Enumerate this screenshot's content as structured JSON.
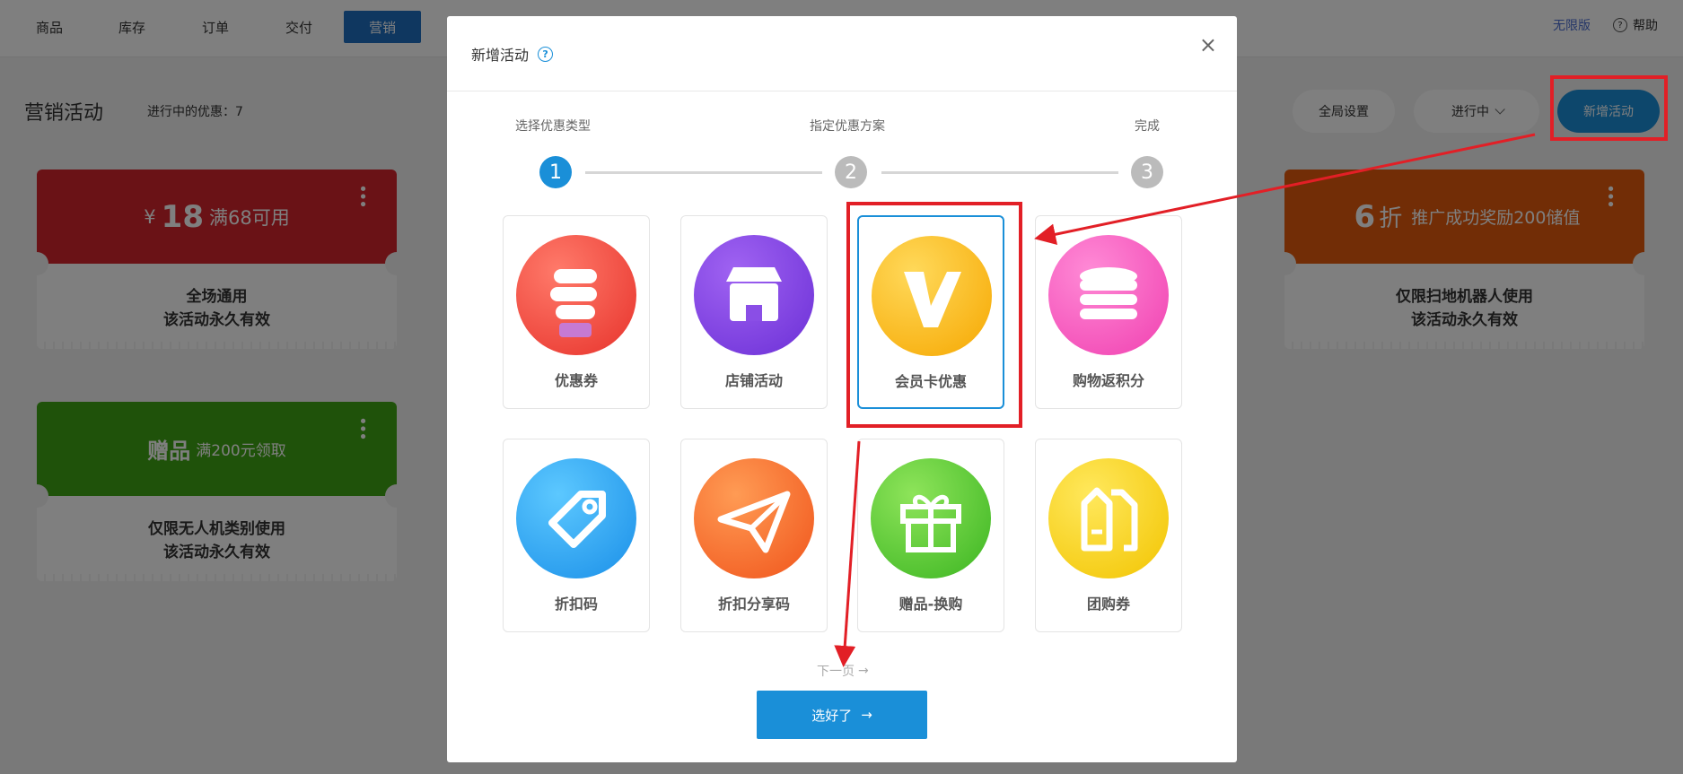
{
  "nav": {
    "tabs": [
      "商品",
      "库存",
      "订单",
      "交付",
      "营销"
    ],
    "active_index": 4,
    "right_link": "无限版",
    "help": "帮助"
  },
  "page": {
    "title": "营销活动",
    "ongoing_label": "进行中的优惠：7",
    "global_settings": "全局设置",
    "status_filter": "进行中",
    "new_activity": "新增活动"
  },
  "cards": [
    {
      "currency": "¥",
      "amount": "18",
      "condition": "满68可用",
      "line1": "全场通用",
      "line2": "该活动永久有效",
      "color": "#d4252c"
    },
    {
      "amount": "赠品",
      "condition": "满200元领取",
      "line1": "仅限无人机类别使用",
      "line2": "该活动永久有效",
      "color": "#3fa514"
    },
    {
      "amount": "6",
      "unit": "折",
      "condition": "推广成功奖励200储值",
      "line1": "仅限扫地机器人使用",
      "line2": "该活动永久有效",
      "color": "#e45a0c"
    }
  ],
  "modal": {
    "title": "新增活动",
    "close": "×",
    "steps": [
      {
        "label": "选择优惠类型",
        "num": "1"
      },
      {
        "label": "指定优惠方案",
        "num": "2"
      },
      {
        "label": "完成",
        "num": "3"
      }
    ],
    "types": [
      {
        "label": "优惠券",
        "icon": "coupon-icon"
      },
      {
        "label": "店铺活动",
        "icon": "store-icon"
      },
      {
        "label": "会员卡优惠",
        "icon": "vip-card-icon"
      },
      {
        "label": "购物返积分",
        "icon": "points-icon"
      },
      {
        "label": "折扣码",
        "icon": "discount-tag-icon"
      },
      {
        "label": "折扣分享码",
        "icon": "paper-plane-icon"
      },
      {
        "label": "赠品-换购",
        "icon": "gift-icon"
      },
      {
        "label": "团购券",
        "icon": "group-tag-icon"
      }
    ],
    "selected_index": 2,
    "next_page": "下一页",
    "confirm": "选好了"
  }
}
